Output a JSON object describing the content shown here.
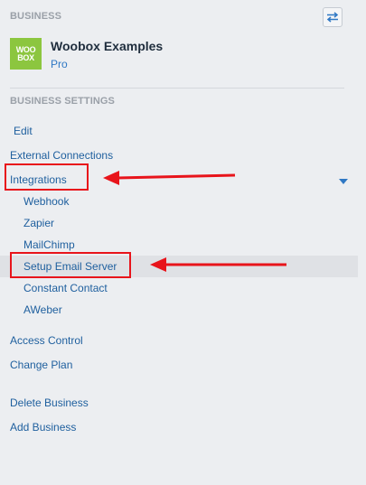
{
  "business": {
    "section_label": "BUSINESS",
    "name": "Woobox Examples",
    "plan": "Pro",
    "logo_lines": [
      "WOO",
      "BOX"
    ],
    "switch_icon": "swap-arrows-icon"
  },
  "settings": {
    "section_label": "BUSINESS SETTINGS",
    "items": {
      "edit": "Edit",
      "external_connections": "External Connections",
      "integrations": "Integrations",
      "access_control": "Access Control",
      "change_plan": "Change Plan",
      "delete_business": "Delete Business",
      "add_business": "Add Business"
    },
    "integrations_sub": {
      "webhook": "Webhook",
      "zapier": "Zapier",
      "mailchimp": "MailChimp",
      "setup_email_server": "Setup Email Server",
      "constant_contact": "Constant Contact",
      "aweber": "AWeber"
    },
    "expanded_item": "Integrations",
    "active_item": "Setup Email Server"
  },
  "colors": {
    "link": "#1e5f9e",
    "accent": "#2f78c4",
    "logo_green": "#8cc63f",
    "annotation_red": "#e8141b",
    "background": "#eceef1",
    "active_row": "#dfe1e5"
  }
}
